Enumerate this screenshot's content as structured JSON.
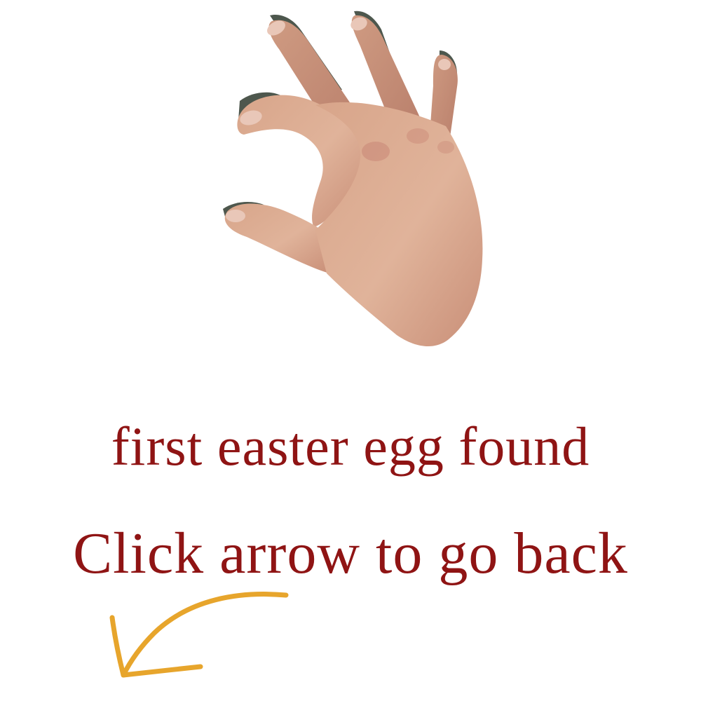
{
  "message": {
    "line1": "first easter egg found",
    "line2": "Click arrow to go back"
  },
  "colors": {
    "text": "#8f1414",
    "arrow": "#e7a52c",
    "skin": "#d9a58b",
    "background": "#ffffff"
  },
  "icons": {
    "hand": "ok-hand-gesture-icon",
    "arrow": "curved-arrow-down-left-icon"
  }
}
